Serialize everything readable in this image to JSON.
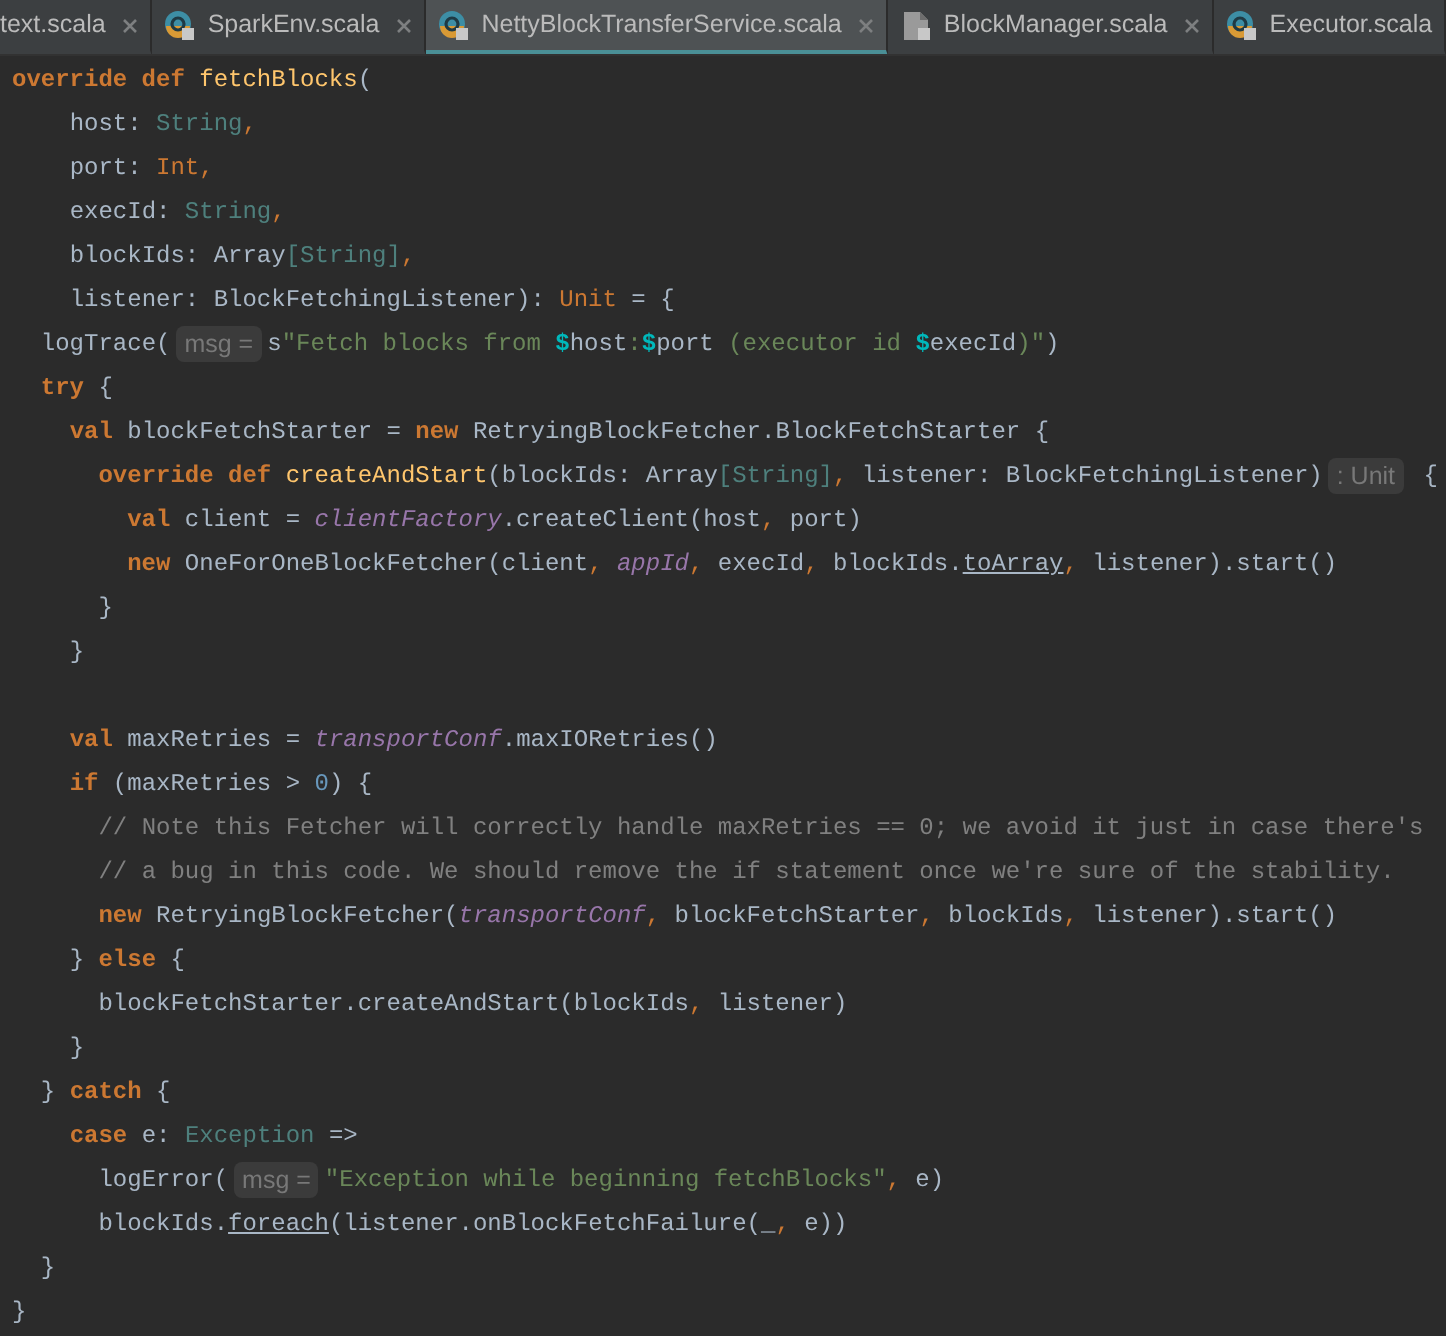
{
  "tabs": [
    {
      "label": "text.scala",
      "selected": false,
      "kind": "plain",
      "closable": true
    },
    {
      "label": "SparkEnv.scala",
      "selected": false,
      "kind": "class",
      "closable": true
    },
    {
      "label": "NettyBlockTransferService.scala",
      "selected": true,
      "kind": "class",
      "closable": true
    },
    {
      "label": "BlockManager.scala",
      "selected": false,
      "kind": "file",
      "closable": true
    },
    {
      "label": "Executor.scala",
      "selected": false,
      "kind": "class",
      "closable": false
    }
  ],
  "code_lines": [
    {
      "kind": "code",
      "tokens": [
        {
          "kind": "kw",
          "text": "override def "
        },
        {
          "kind": "fn",
          "text": "fetchBlocks"
        },
        {
          "kind": "plain",
          "text": "("
        }
      ]
    },
    {
      "kind": "code",
      "tokens": [
        {
          "kind": "plain",
          "text": "    host: "
        },
        {
          "kind": "type",
          "text": "String"
        },
        {
          "kind": "punct",
          "text": ","
        }
      ]
    },
    {
      "kind": "code",
      "tokens": [
        {
          "kind": "plain",
          "text": "    port: "
        },
        {
          "kind": "punct",
          "text": "Int,"
        }
      ]
    },
    {
      "kind": "code",
      "tokens": [
        {
          "kind": "plain",
          "text": "    execId: "
        },
        {
          "kind": "type",
          "text": "String"
        },
        {
          "kind": "punct",
          "text": ","
        }
      ]
    },
    {
      "kind": "code",
      "tokens": [
        {
          "kind": "plain",
          "text": "    blockIds: Array"
        },
        {
          "kind": "type",
          "text": "[String]"
        },
        {
          "kind": "punct",
          "text": ","
        }
      ]
    },
    {
      "kind": "code",
      "tokens": [
        {
          "kind": "plain",
          "text": "    listener: BlockFetchingListener): "
        },
        {
          "kind": "punct",
          "text": "Unit"
        },
        {
          "kind": "plain",
          "text": " = {"
        }
      ]
    },
    {
      "kind": "code",
      "tokens": [
        {
          "kind": "plain",
          "text": "  logTrace("
        },
        {
          "kind": "hint",
          "text": "msg ="
        },
        {
          "kind": "plain",
          "text": "s"
        },
        {
          "kind": "string",
          "text": "\"Fetch blocks from "
        },
        {
          "kind": "dollar",
          "text": "$"
        },
        {
          "kind": "plain",
          "text": "host"
        },
        {
          "kind": "string",
          "text": ":"
        },
        {
          "kind": "dollar",
          "text": "$"
        },
        {
          "kind": "plain",
          "text": "port"
        },
        {
          "kind": "string",
          "text": " (executor id "
        },
        {
          "kind": "dollar",
          "text": "$"
        },
        {
          "kind": "plain",
          "text": "execId"
        },
        {
          "kind": "string",
          "text": ")\""
        },
        {
          "kind": "plain",
          "text": ")"
        }
      ]
    },
    {
      "kind": "code",
      "tokens": [
        {
          "kind": "kw",
          "text": "  try"
        },
        {
          "kind": "plain",
          "text": " {"
        }
      ]
    },
    {
      "kind": "code",
      "tokens": [
        {
          "kind": "kw",
          "text": "    val"
        },
        {
          "kind": "plain",
          "text": " blockFetchStarter = "
        },
        {
          "kind": "kw",
          "text": "new"
        },
        {
          "kind": "plain",
          "text": " RetryingBlockFetcher.BlockFetchStarter {"
        }
      ]
    },
    {
      "kind": "code",
      "tokens": [
        {
          "kind": "kw",
          "text": "      override def "
        },
        {
          "kind": "fn",
          "text": "createAndStart"
        },
        {
          "kind": "plain",
          "text": "(blockIds: Array"
        },
        {
          "kind": "type",
          "text": "[String]"
        },
        {
          "kind": "punct",
          "text": ","
        },
        {
          "kind": "plain",
          "text": " listener: BlockFetchingListener)"
        },
        {
          "kind": "hint",
          "text": ": Unit"
        },
        {
          "kind": "plain",
          "text": " {"
        }
      ]
    },
    {
      "kind": "code",
      "tokens": [
        {
          "kind": "kw",
          "text": "        val"
        },
        {
          "kind": "plain",
          "text": " client = "
        },
        {
          "kind": "field",
          "text": "clientFactory"
        },
        {
          "kind": "plain",
          "text": ".createClient(host"
        },
        {
          "kind": "punct",
          "text": ","
        },
        {
          "kind": "plain",
          "text": " port)"
        }
      ]
    },
    {
      "kind": "code",
      "tokens": [
        {
          "kind": "kw",
          "text": "        new"
        },
        {
          "kind": "plain",
          "text": " OneForOneBlockFetcher(client"
        },
        {
          "kind": "punct",
          "text": ","
        },
        {
          "kind": "field",
          "text": " appId"
        },
        {
          "kind": "punct",
          "text": ","
        },
        {
          "kind": "plain",
          "text": " execId"
        },
        {
          "kind": "punct",
          "text": ","
        },
        {
          "kind": "plain",
          "text": " blockIds."
        },
        {
          "kind": "implicit",
          "text": "toArray"
        },
        {
          "kind": "punct",
          "text": ","
        },
        {
          "kind": "plain",
          "text": " listener).start()"
        }
      ]
    },
    {
      "kind": "code",
      "tokens": [
        {
          "kind": "plain",
          "text": "      }"
        }
      ]
    },
    {
      "kind": "code",
      "tokens": [
        {
          "kind": "plain",
          "text": "    }"
        }
      ]
    },
    {
      "kind": "blank"
    },
    {
      "kind": "code",
      "tokens": [
        {
          "kind": "kw",
          "text": "    val"
        },
        {
          "kind": "plain",
          "text": " maxRetries = "
        },
        {
          "kind": "field",
          "text": "transportConf"
        },
        {
          "kind": "plain",
          "text": ".maxIORetries()"
        }
      ]
    },
    {
      "kind": "code",
      "tokens": [
        {
          "kind": "kw",
          "text": "    if"
        },
        {
          "kind": "plain",
          "text": " (maxRetries > "
        },
        {
          "kind": "number",
          "text": "0"
        },
        {
          "kind": "plain",
          "text": ") {"
        }
      ]
    },
    {
      "kind": "code",
      "tokens": [
        {
          "kind": "comment",
          "text": "      // Note this Fetcher will correctly handle maxRetries == 0; we avoid it just in case there's"
        }
      ]
    },
    {
      "kind": "code",
      "tokens": [
        {
          "kind": "comment",
          "text": "      // a bug in this code. We should remove the if statement once we're sure of the stability."
        }
      ]
    },
    {
      "kind": "code",
      "tokens": [
        {
          "kind": "kw",
          "text": "      new"
        },
        {
          "kind": "plain",
          "text": " RetryingBlockFetcher("
        },
        {
          "kind": "field",
          "text": "transportConf"
        },
        {
          "kind": "punct",
          "text": ","
        },
        {
          "kind": "plain",
          "text": " blockFetchStarter"
        },
        {
          "kind": "punct",
          "text": ","
        },
        {
          "kind": "plain",
          "text": " blockIds"
        },
        {
          "kind": "punct",
          "text": ","
        },
        {
          "kind": "plain",
          "text": " listener).start()"
        }
      ]
    },
    {
      "kind": "code",
      "tokens": [
        {
          "kind": "plain",
          "text": "    } "
        },
        {
          "kind": "kw",
          "text": "else"
        },
        {
          "kind": "plain",
          "text": " {"
        }
      ]
    },
    {
      "kind": "code",
      "tokens": [
        {
          "kind": "plain",
          "text": "      blockFetchStarter.createAndStart(blockIds"
        },
        {
          "kind": "punct",
          "text": ","
        },
        {
          "kind": "plain",
          "text": " listener)"
        }
      ]
    },
    {
      "kind": "code",
      "tokens": [
        {
          "kind": "plain",
          "text": "    }"
        }
      ]
    },
    {
      "kind": "code",
      "tokens": [
        {
          "kind": "plain",
          "text": "  } "
        },
        {
          "kind": "kw",
          "text": "catch"
        },
        {
          "kind": "plain",
          "text": " {"
        }
      ]
    },
    {
      "kind": "code",
      "tokens": [
        {
          "kind": "kw",
          "text": "    case"
        },
        {
          "kind": "plain",
          "text": " e: "
        },
        {
          "kind": "type",
          "text": "Exception"
        },
        {
          "kind": "plain",
          "text": " =>"
        }
      ]
    },
    {
      "kind": "code",
      "tokens": [
        {
          "kind": "plain",
          "text": "      logError("
        },
        {
          "kind": "hint",
          "text": "msg ="
        },
        {
          "kind": "string",
          "text": "\"Exception while beginning fetchBlocks\""
        },
        {
          "kind": "punct",
          "text": ","
        },
        {
          "kind": "plain",
          "text": " e)"
        }
      ]
    },
    {
      "kind": "code",
      "tokens": [
        {
          "kind": "plain",
          "text": "      blockIds."
        },
        {
          "kind": "implicit",
          "text": "foreach"
        },
        {
          "kind": "plain",
          "text": "(listener.onBlockFetchFailure(_"
        },
        {
          "kind": "punct",
          "text": ","
        },
        {
          "kind": "plain",
          "text": " e))"
        }
      ]
    },
    {
      "kind": "code",
      "tokens": [
        {
          "kind": "plain",
          "text": "  }"
        }
      ]
    },
    {
      "kind": "code",
      "tokens": [
        {
          "kind": "plain",
          "text": "}"
        }
      ]
    }
  ]
}
